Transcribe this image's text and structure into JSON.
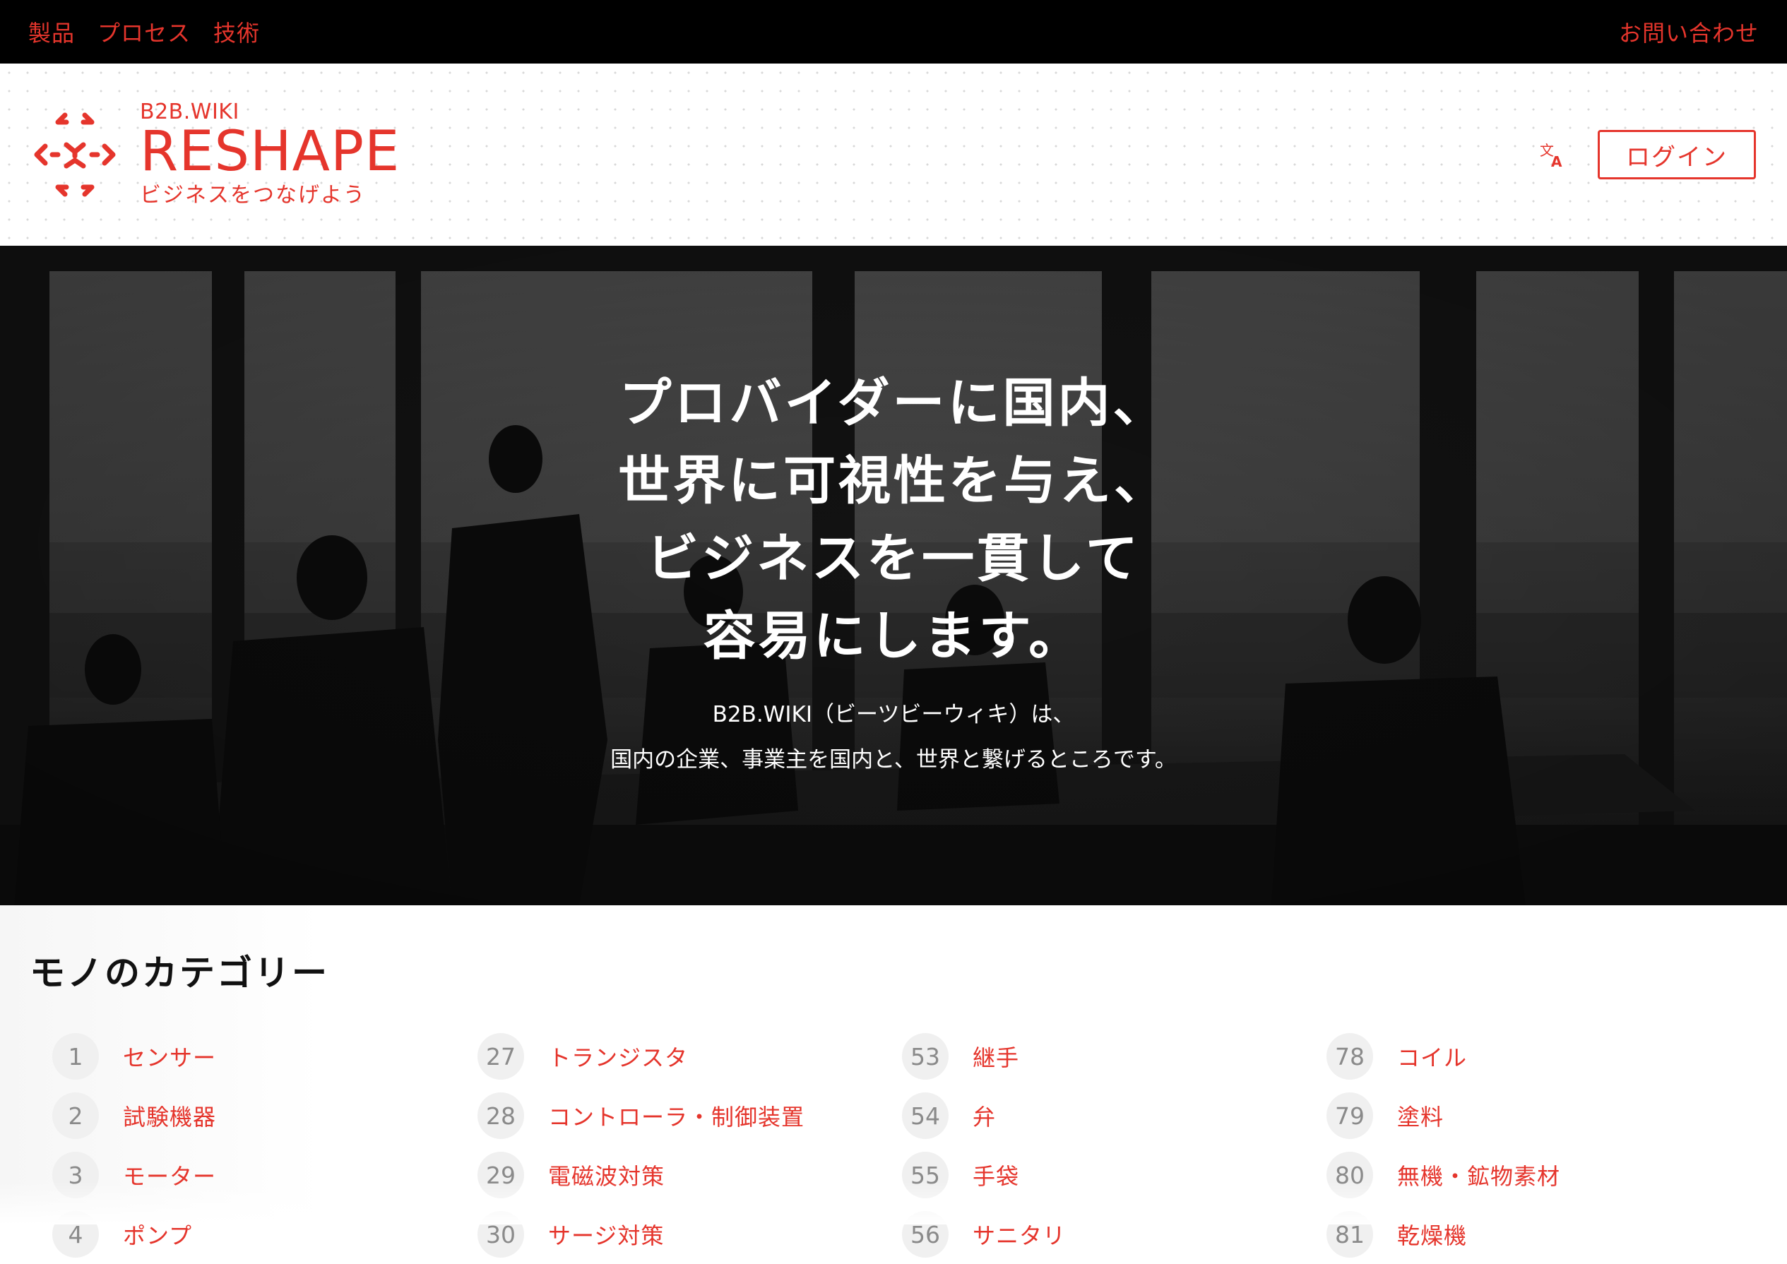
{
  "topbar": {
    "nav": [
      "製品",
      "プロセス",
      "技術"
    ],
    "contact_label": "お問い合わせ"
  },
  "header": {
    "brand_small": "B2B.WIKI",
    "brand_name": "RESHAPE",
    "brand_tagline": "ビジネスをつなげよう",
    "login_label": "ログイン",
    "language_icon": "translate-icon",
    "logo_icon": "reshape-arrows-icon"
  },
  "hero": {
    "title_lines": [
      "プロバイダーに国内、",
      "世界に可視性を与え、",
      "ビジネスを一貫して",
      "容易にします。"
    ],
    "sub_lines": [
      "B2B.WIKI（ビーツビーウィキ）は、",
      "国内の企業、事業主を国内と、世界と繋げるところです。"
    ]
  },
  "categories": {
    "title": "モノのカテゴリー",
    "columns": [
      [
        {
          "num": "1",
          "label": "センサー"
        },
        {
          "num": "2",
          "label": "試験機器"
        },
        {
          "num": "3",
          "label": "モーター"
        },
        {
          "num": "4",
          "label": "ポンプ"
        }
      ],
      [
        {
          "num": "27",
          "label": "トランジスタ"
        },
        {
          "num": "28",
          "label": "コントローラ・制御装置"
        },
        {
          "num": "29",
          "label": "電磁波対策"
        },
        {
          "num": "30",
          "label": "サージ対策"
        }
      ],
      [
        {
          "num": "53",
          "label": "継手"
        },
        {
          "num": "54",
          "label": "弁"
        },
        {
          "num": "55",
          "label": "手袋"
        },
        {
          "num": "56",
          "label": "サニタリ"
        }
      ],
      [
        {
          "num": "78",
          "label": "コイル"
        },
        {
          "num": "79",
          "label": "塗料"
        },
        {
          "num": "80",
          "label": "無機・鉱物素材"
        },
        {
          "num": "81",
          "label": "乾燥機"
        }
      ]
    ]
  },
  "colors": {
    "accent": "#e5352c",
    "topbar_bg": "#000000"
  }
}
